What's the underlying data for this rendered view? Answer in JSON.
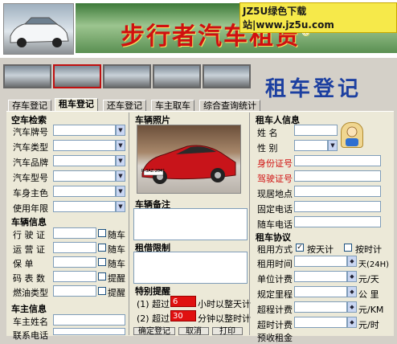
{
  "header": {
    "app_title": "步行者汽车租赁",
    "registered_mark": "®",
    "watermark": "JZ5U绿色下载站|www.jz5u.com",
    "page_title": "租车登记"
  },
  "tabs": [
    {
      "label": "存车登记"
    },
    {
      "label": "租车登记"
    },
    {
      "label": "还车登记"
    },
    {
      "label": "车主取车"
    },
    {
      "label": "综合查询统计"
    }
  ],
  "empty_car_search": {
    "title": "空车检索",
    "fields": [
      {
        "label": "汽车牌号"
      },
      {
        "label": "汽车类型"
      },
      {
        "label": "汽车品牌"
      },
      {
        "label": "汽车型号"
      },
      {
        "label": "车身主色"
      },
      {
        "label": "使用年限"
      }
    ]
  },
  "vehicle_info": {
    "title": "车辆信息",
    "fields": [
      {
        "label": "行 驶 证",
        "check": "随车"
      },
      {
        "label": "运 营 证",
        "check": "随车"
      },
      {
        "label": "保    单",
        "check": "随车"
      },
      {
        "label": "码 表 数",
        "check": "提醒"
      },
      {
        "label": "燃油类型",
        "check": "提醒"
      }
    ]
  },
  "owner_info": {
    "title": "车主信息",
    "fields": [
      {
        "label": "车主姓名"
      },
      {
        "label": "联系电话"
      }
    ]
  },
  "photo": {
    "title": "车辆照片",
    "plate": "R-3AZ.2041"
  },
  "remarks": {
    "title": "车辆备注"
  },
  "rent_limit": {
    "title": "租借限制"
  },
  "reminder": {
    "title": "特别提醒",
    "line1_prefix": "(1) 超过",
    "line1_value": "6",
    "line1_suffix": "小时以整天计",
    "line2_prefix": "(2) 超过",
    "line2_value": "30",
    "line2_suffix": "分钟以整时计"
  },
  "buttons": {
    "save": "确定登记",
    "cancel": "取消",
    "print": "打印"
  },
  "renter_info": {
    "title": "租车人信息",
    "name_label": "姓    名",
    "gender_label": "性    别",
    "fields": [
      {
        "label": "身份证号",
        "color": "#d01010"
      },
      {
        "label": "驾驶证号",
        "color": "#d01010"
      },
      {
        "label": "现居地点"
      },
      {
        "label": "固定电话"
      },
      {
        "label": "随车电话"
      }
    ]
  },
  "rental_agreement": {
    "title": "租车协议",
    "method_label": "租用方式",
    "by_day": "按天计",
    "by_day_checked": true,
    "by_hour": "按时计",
    "by_hour_checked": false,
    "rows": [
      {
        "label": "租用时间",
        "value": "0",
        "unit": "天(24H)"
      },
      {
        "label": "单位计费",
        "value": "0",
        "unit": "元/天"
      },
      {
        "label": "规定里程",
        "value": "0",
        "unit": "公 里"
      },
      {
        "label": "超程计费",
        "value": "0",
        "unit": "元/KM"
      },
      {
        "label": "超时计费",
        "value": "0",
        "unit": "元/时"
      }
    ],
    "deposit_label": "预收租金"
  }
}
